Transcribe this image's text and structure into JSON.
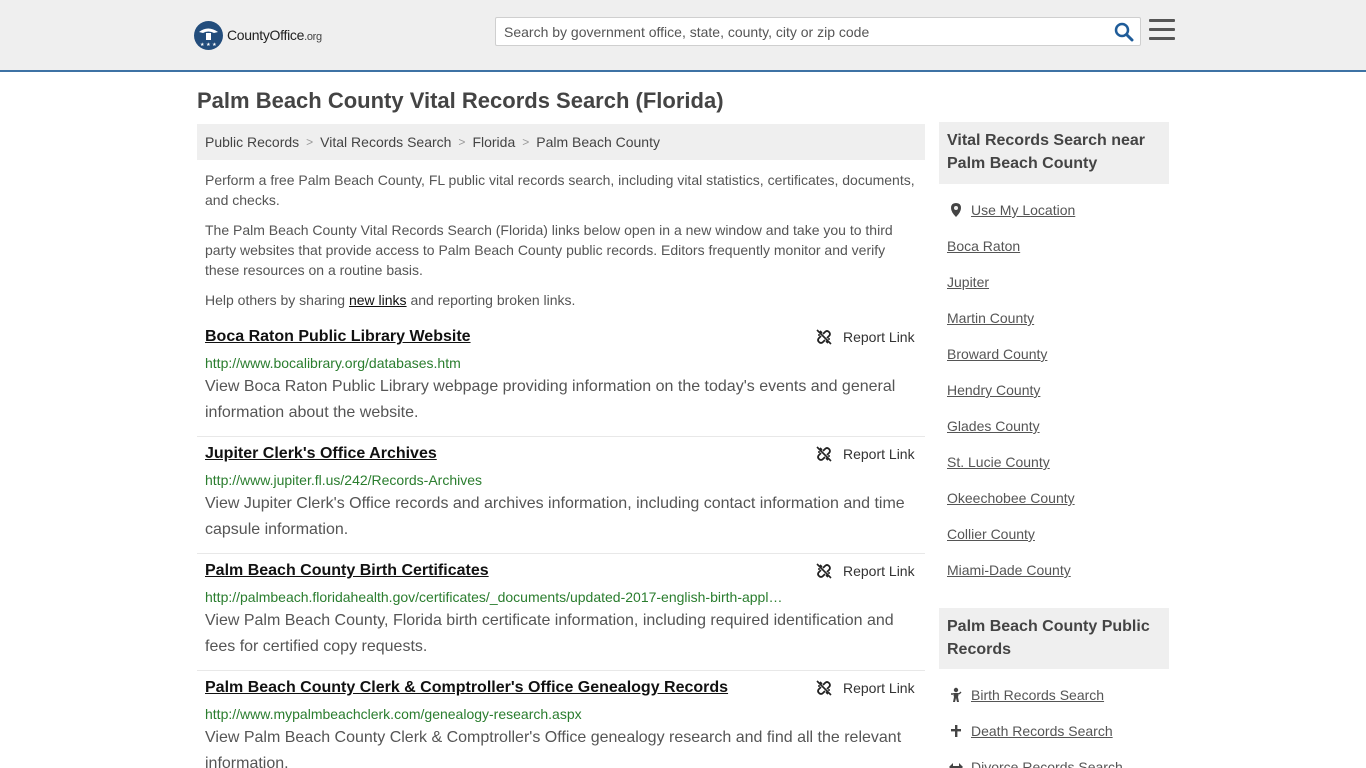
{
  "header": {
    "logo_name": "CountyOffice",
    "logo_tld": ".org",
    "search_placeholder": "Search by government office, state, county, city or zip code"
  },
  "page_title": "Palm Beach County Vital Records Search (Florida)",
  "breadcrumb": [
    "Public Records",
    "Vital Records Search",
    "Florida",
    "Palm Beach County"
  ],
  "intro": {
    "p1": "Perform a free Palm Beach County, FL public vital records search, including vital statistics, certificates, documents, and checks.",
    "p2": "The Palm Beach County Vital Records Search (Florida) links below open in a new window and take you to third party websites that provide access to Palm Beach County public records. Editors frequently monitor and verify these resources on a routine basis.",
    "p3_before": "Help others by sharing ",
    "p3_link": "new links",
    "p3_after": " and reporting broken links."
  },
  "report_label": "Report Link",
  "listings": [
    {
      "title": "Boca Raton Public Library Website",
      "url": "http://www.bocalibrary.org/databases.htm",
      "desc": "View Boca Raton Public Library webpage providing information on the today's events and general information about the website."
    },
    {
      "title": "Jupiter Clerk's Office Archives",
      "url": "http://www.jupiter.fl.us/242/Records-Archives",
      "desc": "View Jupiter Clerk's Office records and archives information, including contact information and time capsule information."
    },
    {
      "title": "Palm Beach County Birth Certificates",
      "url": "http://palmbeach.floridahealth.gov/certificates/_documents/updated-2017-english-birth-appl…",
      "desc": "View Palm Beach County, Florida birth certificate information, including required identification and fees for certified copy requests."
    },
    {
      "title": "Palm Beach County Clerk & Comptroller's Office Genealogy Records",
      "url": "http://www.mypalmbeachclerk.com/genealogy-research.aspx",
      "desc": "View Palm Beach County Clerk & Comptroller's Office genealogy research and find all the relevant information."
    }
  ],
  "sidebar": {
    "nearby_heading": "Vital Records Search near Palm Beach County",
    "use_location": "Use My Location",
    "nearby": [
      "Boca Raton",
      "Jupiter",
      "Martin County",
      "Broward County",
      "Hendry County",
      "Glades County",
      "St. Lucie County",
      "Okeechobee County",
      "Collier County",
      "Miami-Dade County"
    ],
    "public_heading": "Palm Beach County Public Records",
    "public_links": [
      "Birth Records Search",
      "Death Records Search",
      "Divorce Records Search"
    ]
  }
}
